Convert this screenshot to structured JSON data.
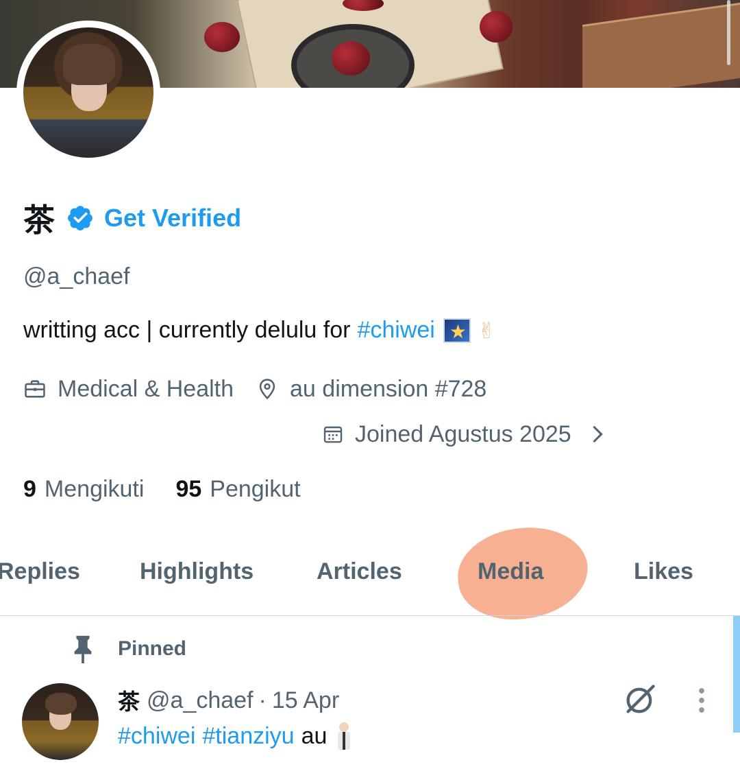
{
  "profile": {
    "display_name": "茶",
    "get_verified_label": "Get Verified",
    "handle": "@a_chaef",
    "bio_text": "writting acc | currently delulu for",
    "bio_hashtag": "#chiwei",
    "bio_emojis": [
      "shooting-star-icon",
      "sign-of-horns-icon"
    ],
    "category": "Medical & Health",
    "location": "au dimension #728",
    "joined": "Joined Agustus 2025",
    "following_count": "9",
    "following_label": "Mengikuti",
    "followers_count": "95",
    "followers_label": "Pengikut"
  },
  "tabs": [
    {
      "label": "Replies"
    },
    {
      "label": "Highlights"
    },
    {
      "label": "Articles"
    },
    {
      "label": "Media",
      "highlighted": true
    },
    {
      "label": "Likes"
    }
  ],
  "pinned_post": {
    "pinned_label": "Pinned",
    "author_name": "茶",
    "author_handle": "@a_chaef",
    "separator": "·",
    "date": "15 Apr",
    "hashtag_1": "#chiwei",
    "hashtag_2": "#tianziyu",
    "text": "au",
    "emoji": "person-in-suit-icon"
  },
  "colors": {
    "accent": "#1d9bf0",
    "text_primary": "#0f1419",
    "text_secondary": "#536471",
    "highlight": "#f7a98a"
  }
}
